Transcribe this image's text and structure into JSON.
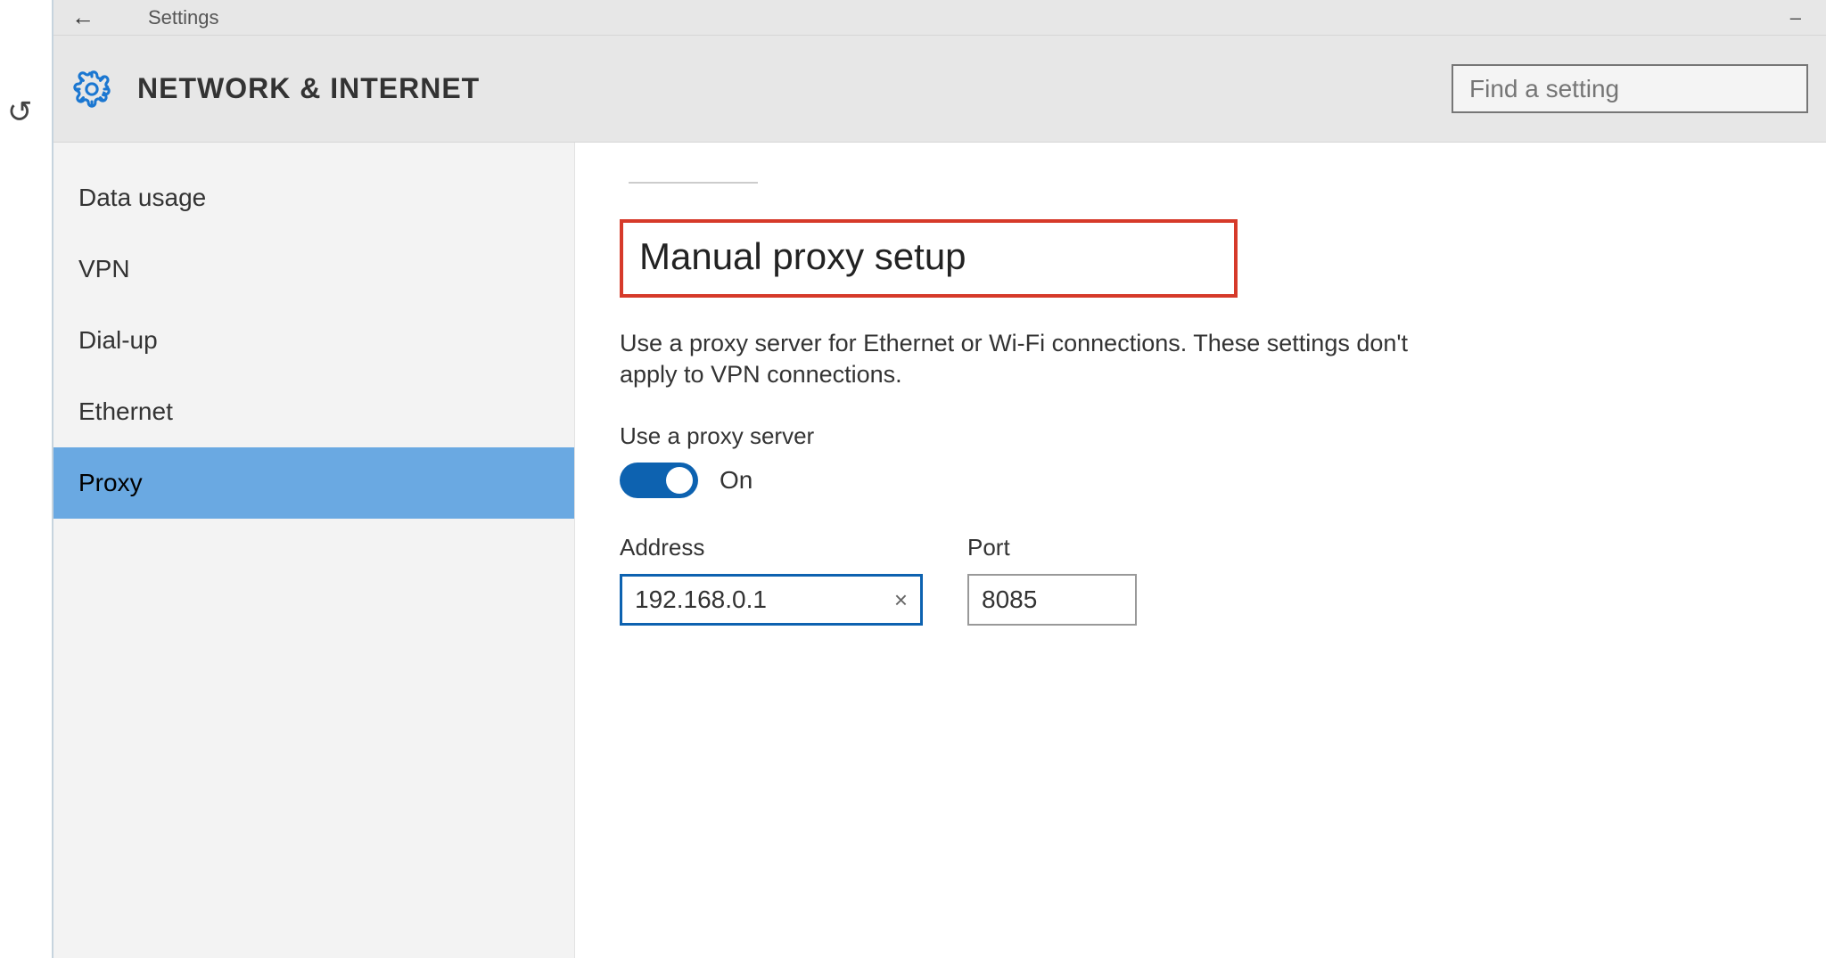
{
  "titlebar": {
    "title": "Settings"
  },
  "header": {
    "title": "NETWORK & INTERNET",
    "search_placeholder": "Find a setting"
  },
  "sidebar": {
    "items": [
      {
        "label": "Data usage"
      },
      {
        "label": "VPN"
      },
      {
        "label": "Dial-up"
      },
      {
        "label": "Ethernet"
      },
      {
        "label": "Proxy"
      }
    ]
  },
  "content": {
    "section_heading": "Manual proxy setup",
    "description": "Use a proxy server for Ethernet or Wi-Fi connections. These settings don't apply to VPN connections.",
    "use_proxy_label": "Use a proxy server",
    "toggle_state": "On",
    "address_label": "Address",
    "address_value": "192.168.0.1",
    "port_label": "Port",
    "port_value": "8085"
  }
}
